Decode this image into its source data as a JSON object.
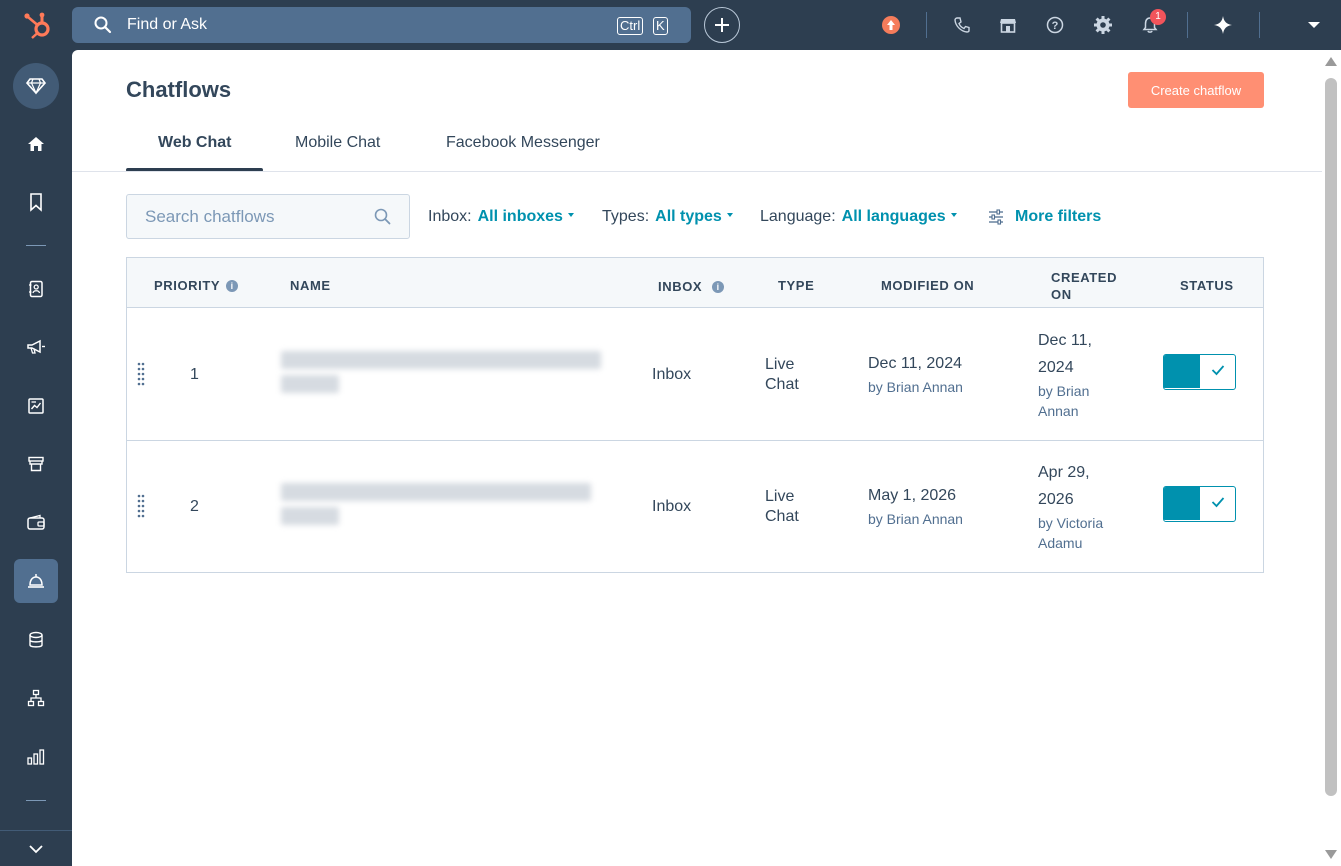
{
  "topbar": {
    "search_label": "Find or Ask",
    "kbd_ctrl": "Ctrl",
    "kbd_k": "K",
    "notification_count": "1"
  },
  "page": {
    "title": "Chatflows",
    "create_button": "Create chatflow"
  },
  "tabs": [
    {
      "label": "Web Chat",
      "active": true
    },
    {
      "label": "Mobile Chat",
      "active": false
    },
    {
      "label": "Facebook Messenger",
      "active": false
    }
  ],
  "filters": {
    "search_placeholder": "Search chatflows",
    "inbox_label": "Inbox:",
    "inbox_value": "All inboxes",
    "types_label": "Types:",
    "types_value": "All types",
    "language_label": "Language:",
    "language_value": "All languages",
    "more_filters": "More filters"
  },
  "table": {
    "headers": {
      "priority": "PRIORITY",
      "name": "NAME",
      "inbox": "INBOX",
      "type": "TYPE",
      "modified": "MODIFIED ON",
      "created_line1": "CREATED",
      "created_line2": "ON",
      "status": "STATUS"
    },
    "rows": [
      {
        "priority": "1",
        "inbox": "Inbox",
        "type_line1": "Live",
        "type_line2": "Chat",
        "modified_date": "Dec 11, 2024",
        "modified_by": "by Brian Annan",
        "created_line1": "Dec 11,",
        "created_line2": "2024",
        "created_by_line1": "by Brian",
        "created_by_line2": "Annan",
        "status_on": true
      },
      {
        "priority": "2",
        "inbox": "Inbox",
        "type_line1": "Live",
        "type_line2": "Chat",
        "modified_date": "May 1, 2026",
        "modified_by": "by Brian Annan",
        "created_line1": "Apr 29,",
        "created_line2": "2026",
        "created_by_line1": "by Victoria",
        "created_by_line2": "Adamu",
        "status_on": true
      }
    ]
  },
  "colors": {
    "nav_bg": "#2d3e50",
    "accent": "#0091ae",
    "create_button": "#ff8f73",
    "notification": "#f2545b",
    "upgrade": "#f57c5b"
  }
}
